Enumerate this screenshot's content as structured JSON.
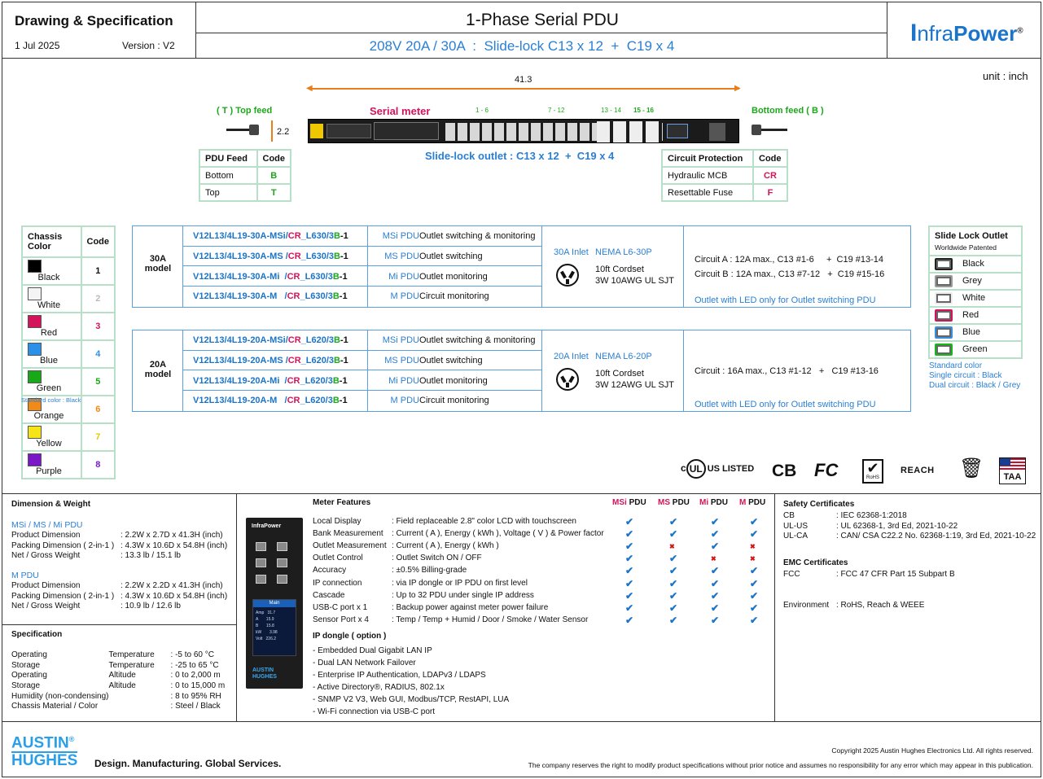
{
  "header": {
    "doc_title": "Drawing & Specification",
    "date": "1 Jul 2025",
    "version": "Version : V2",
    "product_title": "1-Phase Serial PDU",
    "subtitle": "208V 20A / 30A  :  Slide-lock C13 x 12  +  C19 x 4",
    "brand_i": "I",
    "brand_nfra": "nfra",
    "brand_power": "Power",
    "brand_reg": "®"
  },
  "drawing": {
    "unit": "unit : inch",
    "length": "41.3",
    "height": "2.2",
    "top_feed": "( T ) Top feed",
    "bottom_feed": "Bottom feed ( B )",
    "serial_meter": "Serial meter",
    "groups": [
      "1 - 6",
      "7 - 12",
      "13 - 14",
      "15 - 16"
    ],
    "slide_lock": "Slide-lock outlet : C13 x 12  +  C19 x 4"
  },
  "feed_table": {
    "h1": "PDU Feed",
    "h2": "Code",
    "rows": [
      [
        "Bottom",
        "B"
      ],
      [
        "Top",
        "T"
      ]
    ]
  },
  "protection_table": {
    "h1": "Circuit Protection",
    "h2": "Code",
    "rows": [
      [
        "Hydraulic MCB",
        "CR"
      ],
      [
        "Resettable Fuse",
        "F"
      ]
    ]
  },
  "chassis": {
    "h1": "Chassis Color",
    "h2": "Code",
    "rows": [
      {
        "name": "Black",
        "code": "1",
        "color": "#000000",
        "code_color": "#111111"
      },
      {
        "name": "White",
        "code": "2",
        "color": "#f4f4f4",
        "code_color": "#bbbbbb"
      },
      {
        "name": "Red",
        "code": "3",
        "color": "#d3145a",
        "code_color": "#d3145a"
      },
      {
        "name": "Blue",
        "code": "4",
        "color": "#2a90e8",
        "code_color": "#2a90e8"
      },
      {
        "name": "Green",
        "code": "5",
        "color": "#18a818",
        "code_color": "#18a818"
      },
      {
        "name": "Orange",
        "code": "6",
        "color": "#f08a18",
        "code_color": "#f08a18"
      },
      {
        "name": "Yellow",
        "code": "7",
        "color": "#f6e418",
        "code_color": "#e8c800"
      },
      {
        "name": "Purple",
        "code": "8",
        "color": "#7a18c8",
        "code_color": "#7a18c8"
      }
    ],
    "note": "Standard color : Black"
  },
  "models30": {
    "label1": "30A",
    "label2": "model",
    "rows": [
      {
        "a": "V12L13/4L19-30A-MSi/",
        "cr": "CR",
        "b": "_L630/3",
        "bb": "B",
        "c": "-1",
        "type": "MSi PDU",
        "desc": "Outlet switching & monitoring"
      },
      {
        "a": "V12L13/4L19-30A-MS /",
        "cr": "CR",
        "b": "_L630/3",
        "bb": "B",
        "c": "-1",
        "type": "MS PDU",
        "desc": "Outlet switching"
      },
      {
        "a": "V12L13/4L19-30A-Mi  /",
        "cr": "CR",
        "b": "_L630/3",
        "bb": "B",
        "c": "-1",
        "type": "Mi PDU",
        "desc": "Outlet monitoring"
      },
      {
        "a": "V12L13/4L19-30A-M   /",
        "cr": "CR",
        "b": "_L630/3",
        "bb": "B",
        "c": "-1",
        "type": "M PDU",
        "desc": "Circuit monitoring"
      }
    ],
    "inlet": "30A Inlet",
    "nema": "NEMA L6-30P",
    "cord1": "10ft Cordset",
    "cord2": "3W 10AWG UL SJT",
    "circuit1": "Circuit A : 12A max., C13 #1-6     +  C19 #13-14",
    "circuit2": "Circuit B : 12A max., C13 #7-12   +  C19 #15-16",
    "led": "Outlet with LED only for Outlet switching PDU"
  },
  "models20": {
    "label1": "20A",
    "label2": "model",
    "rows": [
      {
        "a": "V12L13/4L19-20A-MSi/",
        "cr": "CR",
        "b": "_L620/3",
        "bb": "B",
        "c": "-1",
        "type": "MSi PDU",
        "desc": "Outlet switching & monitoring"
      },
      {
        "a": "V12L13/4L19-20A-MS /",
        "cr": "CR",
        "b": "_L620/3",
        "bb": "B",
        "c": "-1",
        "type": "MS PDU",
        "desc": "Outlet switching"
      },
      {
        "a": "V12L13/4L19-20A-Mi  /",
        "cr": "CR",
        "b": "_L620/3",
        "bb": "B",
        "c": "-1",
        "type": "Mi PDU",
        "desc": "Outlet monitoring"
      },
      {
        "a": "V12L13/4L19-20A-M   /",
        "cr": "CR",
        "b": "_L620/3",
        "bb": "B",
        "c": "-1",
        "type": "M PDU",
        "desc": "Circuit monitoring"
      }
    ],
    "inlet": "20A Inlet",
    "nema": "NEMA L6-20P",
    "cord1": "10ft Cordset",
    "cord2": "3W 12AWG UL SJT",
    "circuit1": "Circuit : 16A max., C13 #1-12   +   C19 #13-16",
    "led": "Outlet with LED only for Outlet switching PDU"
  },
  "slidelock": {
    "title": "Slide Lock Outlet",
    "sub": "Worldwide Patented",
    "rows": [
      {
        "name": "Black",
        "color": "#222222"
      },
      {
        "name": "Grey",
        "color": "#9a9a9a"
      },
      {
        "name": "White",
        "color": "#eeeeee"
      },
      {
        "name": "Red",
        "color": "#d3145a"
      },
      {
        "name": "Blue",
        "color": "#3a8ee0"
      },
      {
        "name": "Green",
        "color": "#18b818"
      }
    ],
    "note1": "Standard color",
    "note2": "Single circuit : Black",
    "note3": "Dual circuit : Black / Grey"
  },
  "certs": {
    "ul": "US LISTED",
    "cb": "CB",
    "fc": "FC",
    "rohs": "RoHS",
    "reach": "REACH",
    "taa": "TAA"
  },
  "dimension": {
    "title": "Dimension & Weight",
    "g1": "MSi / MS / Mi PDU",
    "g1rows": [
      [
        "Product Dimension",
        ":  2.2W x 2.7D x 41.3H (inch)"
      ],
      [
        "Packing Dimension ( 2-in-1 )",
        ":  4.3W x 10.6D x 54.8H (inch)"
      ],
      [
        "Net / Gross Weight",
        ":  13.3 lb / 15.1 lb"
      ]
    ],
    "g2": "M PDU",
    "g2rows": [
      [
        "Product Dimension",
        ":  2.2W x 2.2D x 41.3H (inch)"
      ],
      [
        "Packing Dimension ( 2-in-1 )",
        ":  4.3W x 10.6D x 54.8H (inch)"
      ],
      [
        "Net / Gross Weight",
        ":  10.9 lb / 12.6 lb"
      ]
    ]
  },
  "specification": {
    "title": "Specification",
    "rows": [
      [
        "Operating",
        "Temperature",
        ":  -5 to 60 °C"
      ],
      [
        "Storage",
        "Temperature",
        ":  -25 to 65 °C"
      ],
      [
        "Operating",
        "Altitude",
        ":  0 to 2,000 m"
      ],
      [
        "Storage",
        "Altitude",
        ":  0 to 15,000 m"
      ],
      [
        "Humidity (non-condensing)",
        "",
        ":  8 to 95% RH"
      ],
      [
        "Chassis Material / Color",
        "",
        ":  Steel / Black"
      ]
    ]
  },
  "meter": {
    "title": "Meter Features",
    "cols": [
      "MSi",
      "MS",
      "Mi",
      "M"
    ],
    "pdu": "PDU",
    "rows": [
      {
        "f": "Local Display",
        "d": ":   Field replaceable 2.8\" color LCD with touchscreen",
        "v": [
          "y",
          "y",
          "y",
          "y"
        ]
      },
      {
        "f": "Bank Measurement",
        "d": ":   Current ( A ), Energy ( kWh ), Voltage ( V ) & Power factor",
        "v": [
          "y",
          "y",
          "y",
          "y"
        ]
      },
      {
        "f": "Outlet Measurement",
        "d": ":   Current ( A ), Energy ( kWh )",
        "v": [
          "y",
          "x",
          "y",
          "x"
        ]
      },
      {
        "f": "Outlet Control",
        "d": ":   Outlet Switch ON / OFF",
        "v": [
          "y",
          "y",
          "x",
          "x"
        ]
      },
      {
        "f": "Accuracy",
        "d": ":   ±0.5% Billing-grade",
        "v": [
          "y",
          "y",
          "y",
          "y"
        ]
      },
      {
        "f": "IP connection",
        "d": ":   via IP dongle or IP PDU on first level",
        "v": [
          "y",
          "y",
          "y",
          "y"
        ]
      },
      {
        "f": "Cascade",
        "d": ":   Up to 32 PDU under single IP address",
        "v": [
          "y",
          "y",
          "y",
          "y"
        ]
      },
      {
        "f": "USB-C port x 1",
        "d": ":   Backup power against meter power failure",
        "v": [
          "y",
          "y",
          "y",
          "y"
        ]
      },
      {
        "f": "Sensor Port x 4",
        "d": ":   Temp / Temp + Humid / Door / Smoke / Water Sensor",
        "v": [
          "y",
          "y",
          "y",
          "y"
        ]
      }
    ],
    "dongle_title": "IP dongle ( option )",
    "dongle": [
      "- Embedded Dual Gigabit LAN IP",
      "- Dual LAN Network Failover",
      "- Enterprise IP Authentication, LDAPv3 / LDAPS",
      "- Active Directory®, RADIUS, 802.1x",
      "- SNMP V2 V3, Web GUI, Modbus/TCP, RestAPI, LUA",
      "- Wi-Fi connection via USB-C port"
    ],
    "img_brand": "InfraPower",
    "img_main": "Main",
    "img_lines": [
      "Amp   31.7",
      "A       15.9",
      "B       15.8",
      "kW       3.98",
      "Volt   226.2"
    ],
    "img_austin": "AUSTIN",
    "img_hughes": "HUGHES"
  },
  "safety": {
    "title": "Safety Certificates",
    "rows": [
      [
        "CB",
        ":  IEC 62368-1:2018"
      ],
      [
        "UL-US",
        ":  UL 62368-1, 3rd Ed, 2021-10-22"
      ],
      [
        "UL-CA",
        ":  CAN/ CSA C22.2 No. 62368-1:19, 3rd Ed, 2021-10-22"
      ]
    ],
    "emc_title": "EMC Certificates",
    "emc": [
      "FCC",
      ":  FCC 47 CFR Part 15 Subpart B"
    ],
    "env_label": "Environment",
    "env": ":  RoHS, Reach & WEEE"
  },
  "footer": {
    "austin": "AUSTIN",
    "hughes": "HUGHES",
    "reg": "®",
    "tagline": "Design. Manufacturing. Global Services.",
    "copyright": "Copyright 2025 Austin Hughes Electronics Ltd. All rights reserved.",
    "disclaimer": "The company reserves the right to modify product specifications without prior notice and assumes no responsibility for any error which may appear in this publication."
  }
}
